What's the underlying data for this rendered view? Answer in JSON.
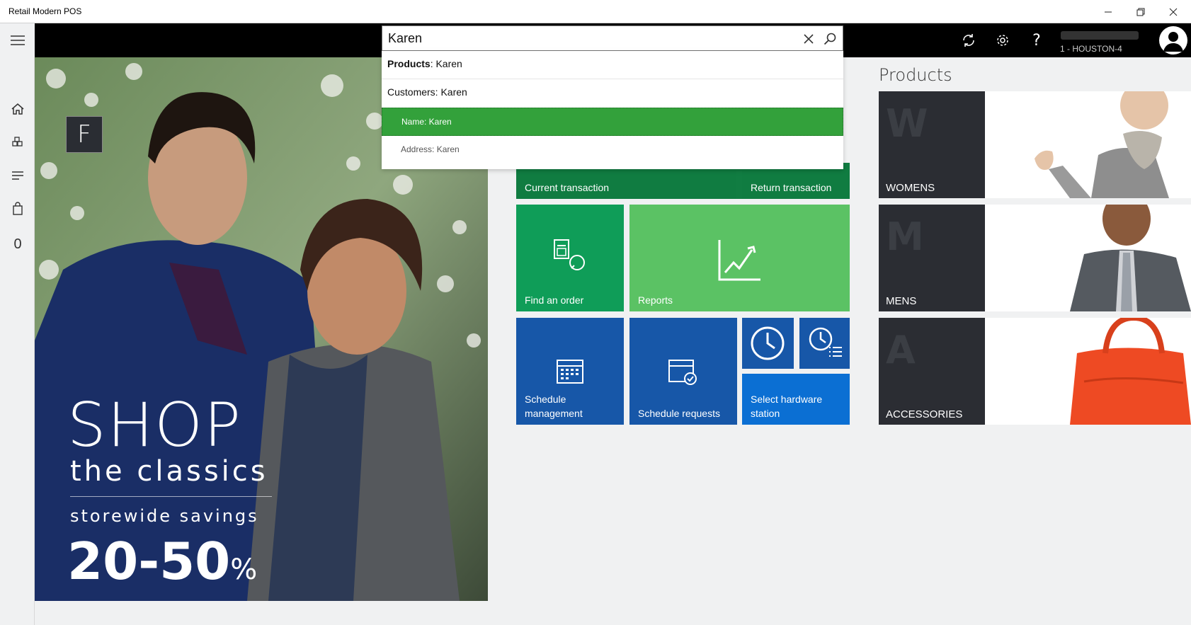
{
  "window": {
    "title": "Retail Modern POS"
  },
  "search": {
    "value": "Karen"
  },
  "dropdown": {
    "products_prefix": "Products",
    "products_suffix": ": Karen",
    "customers": "Customers: Karen",
    "name": "Name: Karen",
    "address": "Address: Karen"
  },
  "header": {
    "store_label": "1 - HOUSTON-4"
  },
  "sidebar": {
    "cart_count": "0"
  },
  "hero": {
    "logo_letter": "F",
    "line1": "SHOP",
    "line2": "the classics",
    "line3": "storewide savings",
    "line4": "20-50",
    "line4_suffix": "%"
  },
  "tiles": {
    "current_transaction": "Current transaction",
    "return_transaction": "Return transaction",
    "find_order": "Find an order",
    "reports": "Reports",
    "schedule_management_1": "Schedule",
    "schedule_management_2": "management",
    "schedule_requests": "Schedule requests",
    "select_hw_1": "Select hardware",
    "select_hw_2": "station"
  },
  "products": {
    "title": "Products",
    "categories": [
      {
        "letter": "W",
        "label": "WOMENS"
      },
      {
        "letter": "M",
        "label": "MENS"
      },
      {
        "letter": "A",
        "label": "ACCESSORIES"
      }
    ]
  },
  "colors": {
    "dark_green": "#107c41",
    "green": "#16a05a",
    "light_green": "#5cc264",
    "blue": "#1756a6",
    "bright_blue": "#0a6fd3",
    "selected_green": "#33a13b"
  }
}
